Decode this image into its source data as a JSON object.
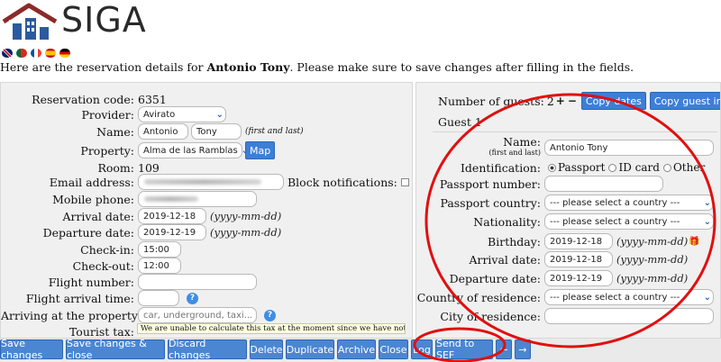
{
  "app": {
    "title": "SIGA"
  },
  "header": {
    "flags": [
      {
        "name": "uk-flag-icon",
        "c1": "#012169",
        "c2": "#c8102e"
      },
      {
        "name": "pt-flag-icon",
        "c1": "#046a38",
        "c2": "#da291c"
      },
      {
        "name": "fr-flag-icon",
        "c1": "#0055a4",
        "c2": "#ef4135"
      },
      {
        "name": "es-flag-icon",
        "c1": "#c60b1e",
        "c2": "#ffc400"
      },
      {
        "name": "de-flag-icon",
        "c1": "#000000",
        "c2": "#dd0000"
      }
    ],
    "intro_pre": "Here are the reservation details for ",
    "guest_name": "Antonio Tony",
    "intro_post": ". Please make sure to save changes after filling in the fields."
  },
  "left": {
    "reservation_code": {
      "label": "Reservation code:",
      "value": "6351"
    },
    "provider": {
      "label": "Provider:",
      "value": "Avirato"
    },
    "name": {
      "label": "Name:",
      "first": "Antonio",
      "last": "Tony",
      "hint": "(first and last)"
    },
    "property": {
      "label": "Property:",
      "value": "Alma de las Ramblas",
      "map_button": "Map"
    },
    "room": {
      "label": "Room:",
      "value": "109"
    },
    "email": {
      "label": "Email address:",
      "block_label": "Block notifications:"
    },
    "mobile": {
      "label": "Mobile phone:"
    },
    "arrival": {
      "label": "Arrival date:",
      "value": "2019-12-18",
      "hint": "(yyyy-mm-dd)"
    },
    "departure": {
      "label": "Departure date:",
      "value": "2019-12-19",
      "hint": "(yyyy-mm-dd)"
    },
    "checkin": {
      "label": "Check-in:",
      "value": "15:00"
    },
    "checkout": {
      "label": "Check-out:",
      "value": "12:00"
    },
    "flight_number": {
      "label": "Flight number:"
    },
    "flight_arrival": {
      "label": "Flight arrival time:"
    },
    "arriving_by": {
      "label": "Arriving at the property by:",
      "placeholder": "car, underground, taxi..."
    },
    "tourist_tax": {
      "label": "Tourist tax:"
    },
    "tooltip": "We are unable to calculate this tax at the moment since we have not yet"
  },
  "right": {
    "guests": {
      "label": "Number of guests:",
      "value": "2",
      "plus": "+",
      "minus": "−",
      "copy_dates": "Copy dates",
      "copy_guest_info": "Copy guest info"
    },
    "guest_title": "Guest 1",
    "name": {
      "label": "Name:",
      "sublabel": "(first and last)",
      "value": "Antonio Tony"
    },
    "identification": {
      "label": "Identification:",
      "options": [
        "Passport",
        "ID card",
        "Other"
      ]
    },
    "passport_number": {
      "label": "Passport number:"
    },
    "passport_country": {
      "label": "Passport country:",
      "value": "--- please select a country ---"
    },
    "nationality": {
      "label": "Nationality:",
      "value": "--- please select a country ---"
    },
    "birthday": {
      "label": "Birthday:",
      "value": "2019-12-18",
      "hint": "(yyyy-mm-dd)"
    },
    "arrival": {
      "label": "Arrival date:",
      "value": "2019-12-18",
      "hint": "(yyyy-mm-dd)"
    },
    "departure": {
      "label": "Departure date:",
      "value": "2019-12-19",
      "hint": "(yyyy-mm-dd)"
    },
    "residence_country": {
      "label": "Country of residence:",
      "value": "--- please select a country ---"
    },
    "residence_city": {
      "label": "City of residence:"
    }
  },
  "toolbar": {
    "save": "Save changes",
    "save_close": "Save changes & close",
    "discard": "Discard changes",
    "delete": "Delete",
    "duplicate": "Duplicate",
    "archive": "Archive",
    "close": "Close",
    "log": "Log",
    "send_sef": "Send to SEF",
    "prev": "←",
    "next": "→"
  },
  "colors": {
    "accent": "#3d7fd6",
    "annotation": "#e01010",
    "panel": "#f0f0f0"
  }
}
